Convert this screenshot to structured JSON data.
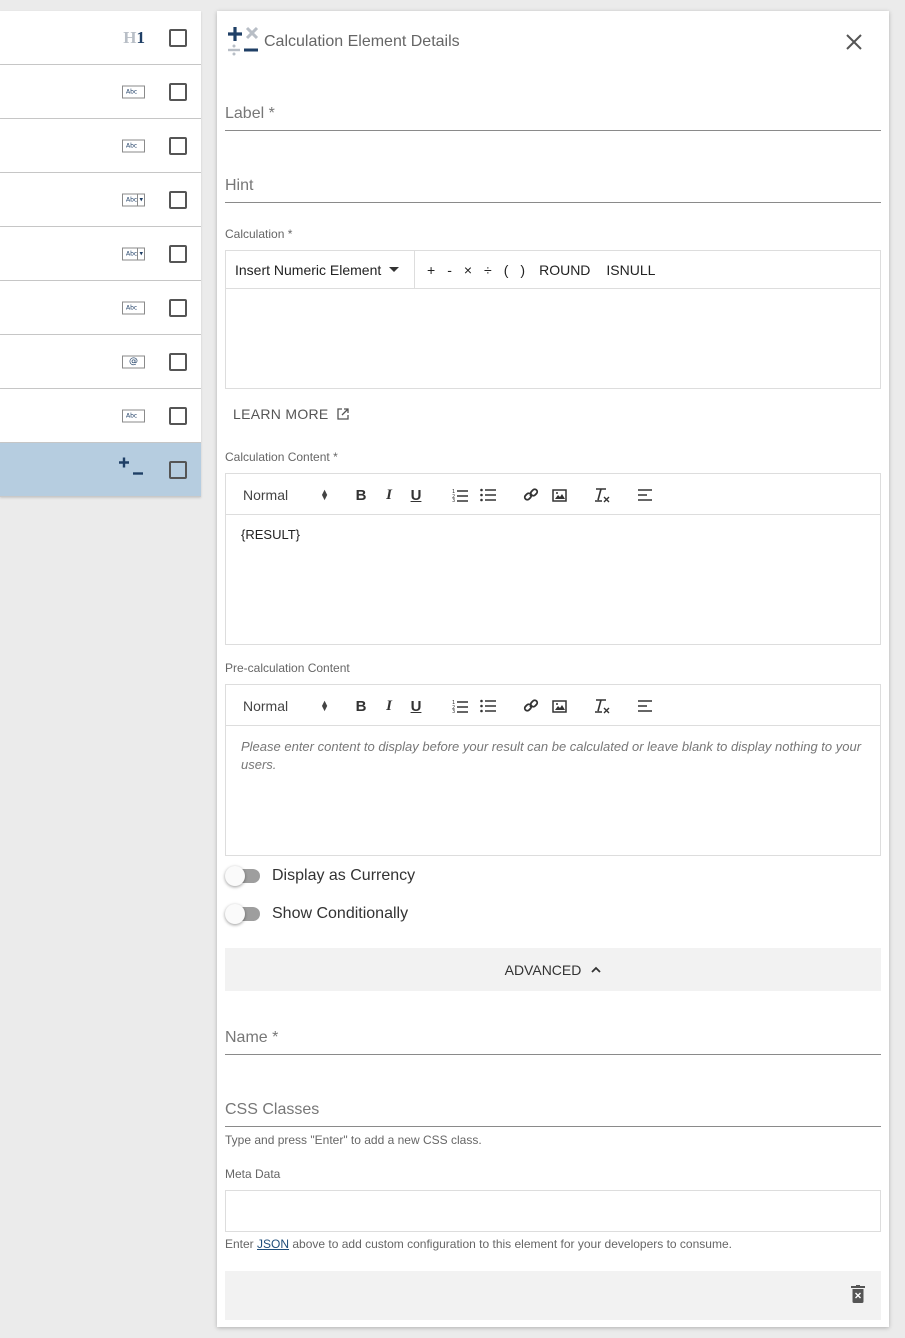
{
  "element_list": {
    "rows": [
      {
        "icon": "heading-icon",
        "icon_text": "H",
        "icon_num": "1"
      },
      {
        "icon": "text-field-icon",
        "icon_text": "Abc"
      },
      {
        "icon": "text-field-icon",
        "icon_text": "Abc"
      },
      {
        "icon": "dropdown-field-icon",
        "icon_text": "Abc"
      },
      {
        "icon": "dropdown-field-icon",
        "icon_text": "Abc"
      },
      {
        "icon": "text-field-icon",
        "icon_text": "Abc"
      },
      {
        "icon": "email-field-icon",
        "icon_text": "@"
      },
      {
        "icon": "text-field-icon",
        "icon_text": "Abc"
      },
      {
        "icon": "calculation-icon",
        "active": true
      }
    ]
  },
  "panel": {
    "title": "Calculation Element Details",
    "label_field": {
      "label": "Label *"
    },
    "hint_field": {
      "label": "Hint"
    },
    "calculation": {
      "label": "Calculation *",
      "insert_label": "Insert Numeric Element",
      "operators": [
        "+",
        "-",
        "×",
        "÷",
        "(",
        ")",
        "ROUND",
        "ISNULL"
      ]
    },
    "learn_more": "LEARN MORE",
    "calc_content": {
      "label": "Calculation Content *",
      "format": "Normal",
      "body": "{RESULT}"
    },
    "pre_calc_content": {
      "label": "Pre-calculation Content",
      "format": "Normal",
      "placeholder": "Please enter content to display before your result can be calculated or leave blank to display nothing to your users."
    },
    "toggles": {
      "currency": "Display as Currency",
      "conditional": "Show Conditionally"
    },
    "advanced": "ADVANCED",
    "name_field": {
      "label": "Name *"
    },
    "css_field": {
      "label": "CSS Classes",
      "helper": "Type and press \"Enter\" to add a new CSS class."
    },
    "meta": {
      "label": "Meta Data",
      "helper_before": "Enter ",
      "helper_link": "JSON",
      "helper_after": " above to add custom configuration to this element for your developers to consume."
    }
  },
  "colors": {
    "brand_navy": "#1f3f66",
    "active_row": "#b6cde0"
  }
}
